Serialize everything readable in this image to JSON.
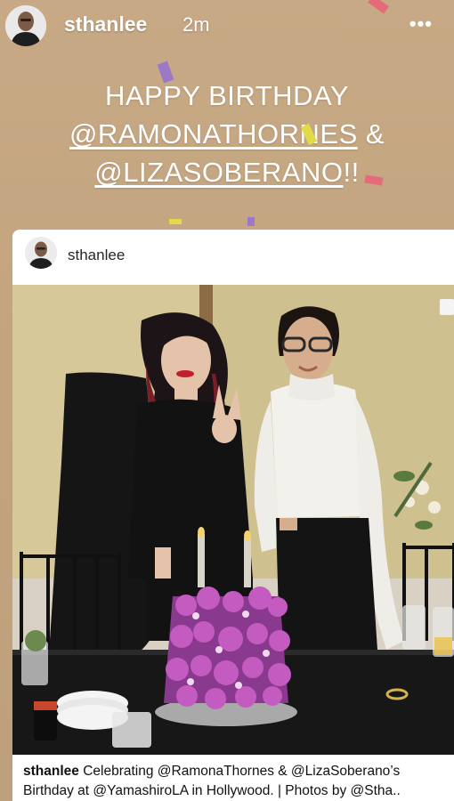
{
  "story": {
    "username": "sthanlee",
    "time_ago": "2m",
    "more_label": "•••",
    "greeting": {
      "line1": "HAPPY BIRTHDAY",
      "mention1": "@RAMONATHORNES",
      "joiner": " &",
      "mention2": "@LIZASOBERANO",
      "suffix": "!!"
    }
  },
  "post": {
    "username": "sthanlee",
    "caption_user": "sthanlee",
    "caption_line1": "Celebrating @RamonaThornes & @LizaSoberano’s",
    "caption_line2": "Birthday at @YamashiroLA in Hollywood. | Photos by @Stha.."
  },
  "colors": {
    "story_background": "#c4a57f",
    "text": "#ffffff"
  },
  "icons": [
    "more-options-icon"
  ]
}
